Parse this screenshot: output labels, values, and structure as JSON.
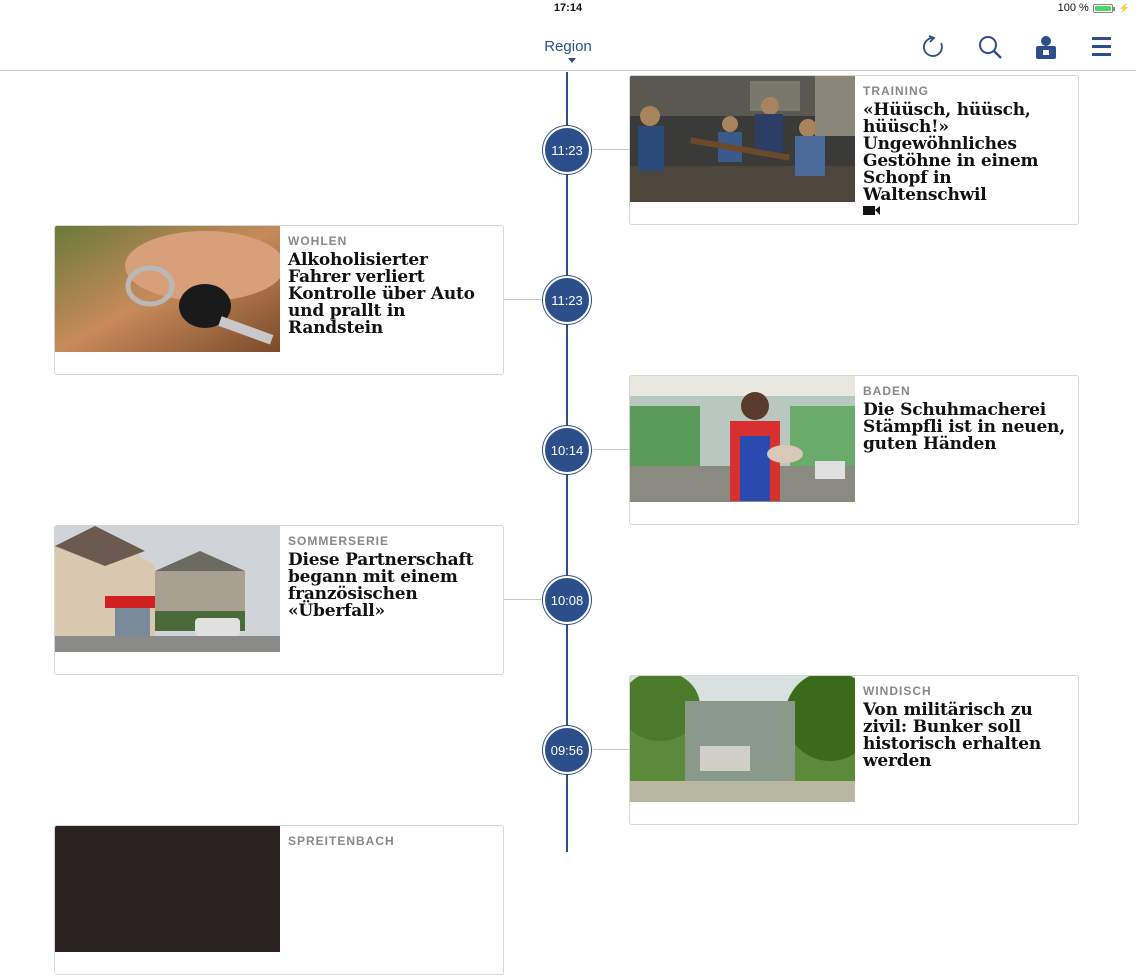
{
  "status": {
    "time": "17:14",
    "battery": "100 %",
    "battery_level": 1.0
  },
  "header": {
    "title": "Region"
  },
  "colors": {
    "accent": "#2c4e8a",
    "divider": "#c8c8c8",
    "category": "#888888"
  },
  "icons": [
    "refresh-icon",
    "search-icon",
    "user-icon",
    "menu-icon",
    "video-icon"
  ],
  "articles": [
    {
      "time": "11:23",
      "category": "TRAINING",
      "headline": "«Hüüsch, hüüsch, hüüsch!» Ungewöhnliches Gestöhne in einem Schopf in Waltenschwil",
      "has_video": true
    },
    {
      "time": "11:23",
      "category": "WOHLEN",
      "headline": "Alkoholisierter Fahrer verliert Kontrolle über Auto und prallt in Randstein",
      "has_video": false
    },
    {
      "time": "10:14",
      "category": "BADEN",
      "headline": "Die Schuhmacherei Stämpfli ist in neuen, guten Händen",
      "has_video": false
    },
    {
      "time": "10:08",
      "category": "SOMMERSERIE",
      "headline": "Diese Partnerschaft begann mit einem französischen «Überfall»",
      "has_video": false
    },
    {
      "time": "09:56",
      "category": "WINDISCH",
      "headline": "Von militärisch zu zivil: Bunker soll historisch erhalten werden",
      "has_video": false
    },
    {
      "time": "",
      "category": "SPREITENBACH",
      "headline": "",
      "has_video": false
    }
  ]
}
